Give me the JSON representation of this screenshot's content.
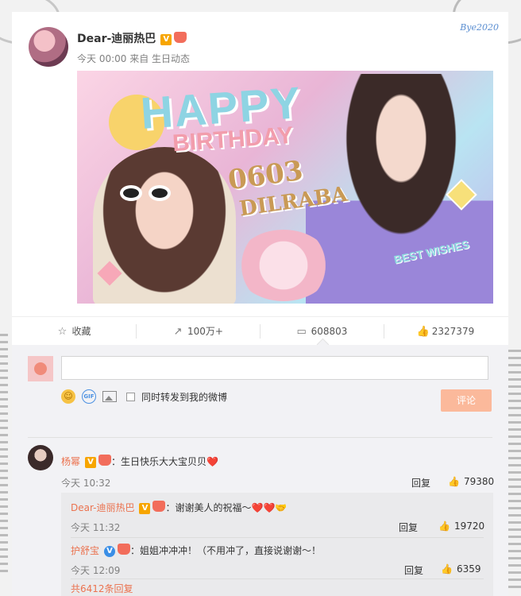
{
  "post": {
    "username": "Dear-迪丽热巴",
    "verified_badge": "V",
    "meta": "今天 00:00 来自 生日动态",
    "card_badge": "Bye2020",
    "banner": {
      "line1": "HAPPY",
      "line2": "BIRTHDAY",
      "line3": "0603",
      "line4": "DILRABA",
      "line5": "BEST WISHES"
    }
  },
  "actions": {
    "favorite": "收藏",
    "repost": "100万+",
    "comment": "608803",
    "like": "2327379"
  },
  "composer": {
    "input_value": "",
    "forward_label": "同时转发到我的微博",
    "submit_label": "评论"
  },
  "comment": {
    "user": "杨幂",
    "text": "：生日快乐大大宝贝贝",
    "heart": "❤️",
    "time": "今天 10:32",
    "reply_label": "回复",
    "likes": "79380"
  },
  "replies": [
    {
      "user": "Dear-迪丽热巴",
      "text": "：谢谢美人的祝福～",
      "emoji": "❤️❤️🤝",
      "time": "今天 11:32",
      "reply_label": "回复",
      "likes": "19720"
    },
    {
      "user": "护舒宝",
      "text": "：姐姐冲冲冲！（不用冲了，直接说谢谢～！",
      "emoji": "",
      "time": "今天 12:09",
      "reply_label": "回复",
      "likes": "6359"
    }
  ],
  "more_replies": "共6412条回复"
}
